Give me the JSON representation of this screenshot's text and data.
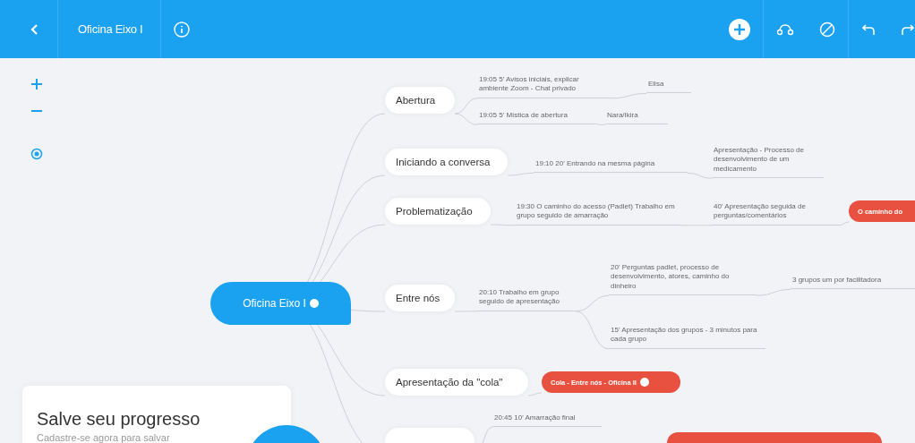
{
  "toolbar": {
    "title": "Oficina Eixo I"
  },
  "map": {
    "root": {
      "label": "Oficina Eixo I",
      "children": [
        {
          "kind": "main",
          "label": "Abertura",
          "children": [
            {
              "kind": "sub",
              "label": "19:05 5' Avisos iniciais, explicar ambiente Zoom - Chat privado",
              "children": [
                {
                  "kind": "sub",
                  "label": "Elisa"
                }
              ]
            },
            {
              "kind": "sub",
              "label": "19:05 5' Mística de abertura",
              "children": [
                {
                  "kind": "sub",
                  "label": "Nara/Ikira"
                }
              ]
            }
          ]
        },
        {
          "kind": "main",
          "label": "Iniciando a conversa",
          "children": [
            {
              "kind": "sub",
              "label": "19:10 20' Entrando na mesma página",
              "children": [
                {
                  "kind": "sub",
                  "label": "Apresentação - Processo de desenvolvimento de um medicamento"
                }
              ]
            }
          ]
        },
        {
          "kind": "main",
          "label": "Problematização",
          "children": [
            {
              "kind": "sub",
              "label": "19:30 O caminho do acesso (Padlet) Trabalho em grupo seguido de amarração",
              "children": [
                {
                  "kind": "sub",
                  "label": "40' Apresentação seguida de perguntas/comentários",
                  "children": [
                    {
                      "kind": "filled",
                      "label": "O caminho do"
                    }
                  ]
                }
              ]
            }
          ]
        },
        {
          "kind": "main",
          "label": "Entre nós",
          "children": [
            {
              "kind": "sub",
              "label": "20:10 Trabalho em grupo seguido de apresentação",
              "children": [
                {
                  "kind": "sub",
                  "label": "20' Perguntas padlet, processo de desenvolvimento, atores, caminho do dinheiro",
                  "children": [
                    {
                      "kind": "sub",
                      "label": "3 grupos um por facilitadora"
                    }
                  ]
                },
                {
                  "kind": "sub",
                  "label": "15' Apresentação dos grupos - 3 minutos para cada grupo"
                }
              ]
            }
          ]
        },
        {
          "kind": "main",
          "label": "Apresentação da \"cola\"",
          "children": [
            {
              "kind": "filled",
              "label": "Cola - Entre nós - Oficina II",
              "link": true
            }
          ]
        },
        {
          "kind": "main",
          "children": [
            {
              "kind": "sub",
              "label": "20:45  10' Amarração final"
            },
            {
              "kind": "filled"
            }
          ]
        }
      ]
    }
  },
  "signup_card": {
    "title": "Salve seu progresso",
    "subtitle": "Cadastre-se agora para salvar"
  }
}
